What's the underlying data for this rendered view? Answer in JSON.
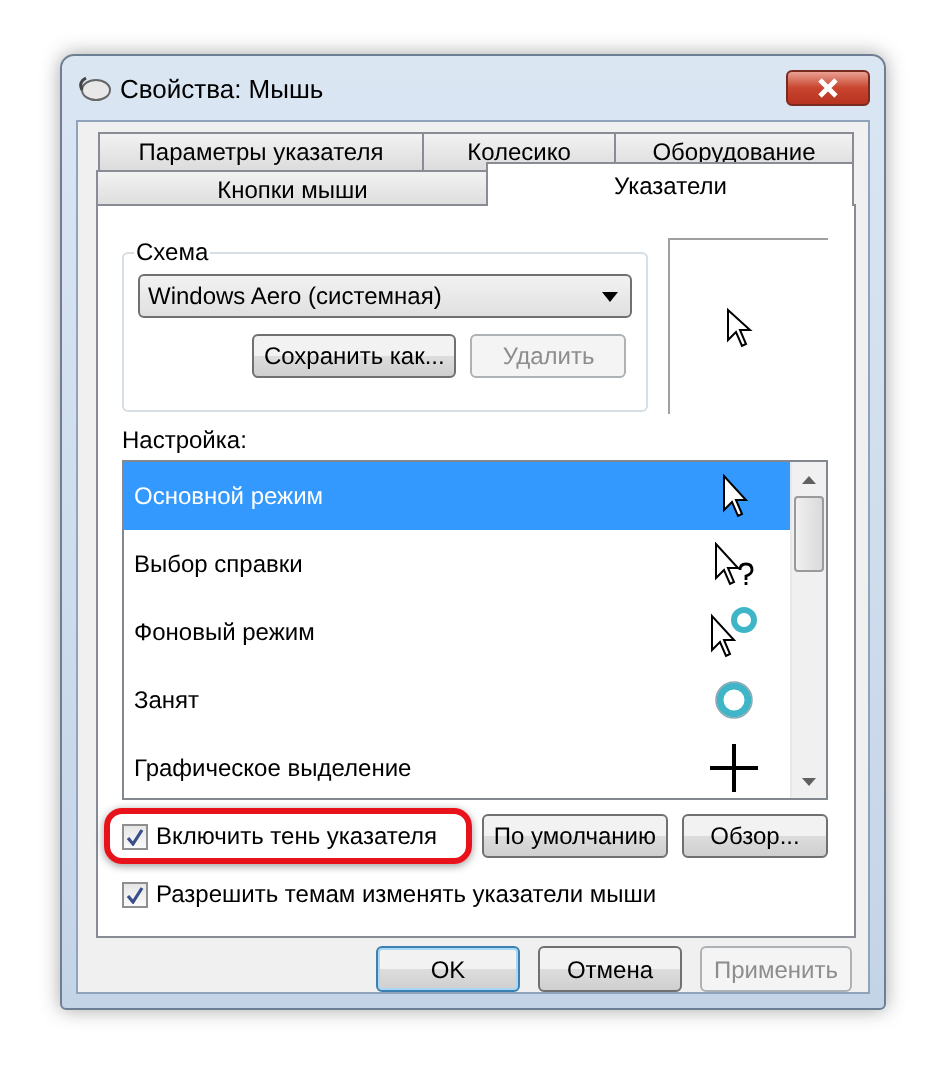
{
  "window": {
    "title": "Свойства: Мышь"
  },
  "tab_rows": [
    [
      {
        "label": "Параметры указателя",
        "selected": false
      },
      {
        "label": "Колесико",
        "selected": false
      },
      {
        "label": "Оборудование",
        "selected": false
      }
    ],
    [
      {
        "label": "Кнопки мыши",
        "selected": false
      },
      {
        "label": "Указатели",
        "selected": true
      }
    ]
  ],
  "scheme": {
    "legend": "Схема",
    "value": "Windows Aero (системная)",
    "buttons": [
      {
        "label": "Сохранить как...",
        "disabled": false
      },
      {
        "label": "Удалить",
        "disabled": true
      }
    ]
  },
  "customize": {
    "label": "Настройка:",
    "items": [
      {
        "label": "Основной режим",
        "selected": true
      },
      {
        "label": "Выбор справки",
        "selected": false
      },
      {
        "label": "Фоновый режим",
        "selected": false
      },
      {
        "label": "Занят",
        "selected": false
      },
      {
        "label": "Графическое выделение",
        "selected": false
      }
    ]
  },
  "options": [
    {
      "label": "Включить тень указателя",
      "checked": true,
      "highlighted": true
    },
    {
      "label": "Разрешить темам изменять указатели мыши",
      "checked": true,
      "highlighted": false
    }
  ],
  "option_buttons": [
    {
      "label": "По умолчанию",
      "disabled": false
    },
    {
      "label": "Обзор...",
      "disabled": false
    }
  ],
  "dialog_buttons": [
    {
      "label": "OK",
      "disabled": false,
      "default": true
    },
    {
      "label": "Отмена",
      "disabled": false,
      "default": false
    },
    {
      "label": "Применить",
      "disabled": true,
      "default": false
    }
  ]
}
